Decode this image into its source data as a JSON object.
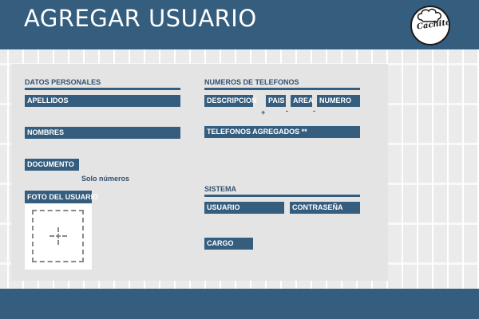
{
  "header": {
    "title": "AGREGAR USUARIO",
    "logo_text": "Cachito"
  },
  "datos_personales": {
    "section_title": "DATOS PERSONALES",
    "apellidos_label": "APELLIDOS",
    "nombres_label": "NOMBRES",
    "documento_label": "DOCUMENTO",
    "documento_hint": "Solo números",
    "foto_label": "FOTO DEL USUARIO"
  },
  "telefonos": {
    "section_title": "NUMEROS DE TELEFONOS",
    "descripcion_label": "DESCRIPCION",
    "pais_label": "PAIS",
    "area_label": "AREA",
    "numero_label": "NUMERO",
    "plus_sign": "+",
    "dash_sign": "-",
    "agregados_label": "TELEFONOS AGREGADOS **"
  },
  "sistema": {
    "section_title": "SISTEMA",
    "usuario_label": "USUARIO",
    "contrasena_label": "CONTRASEÑA",
    "cargo_label": "CARGO"
  },
  "colors": {
    "primary": "#355d7e",
    "panel": "#e4e4e4"
  }
}
